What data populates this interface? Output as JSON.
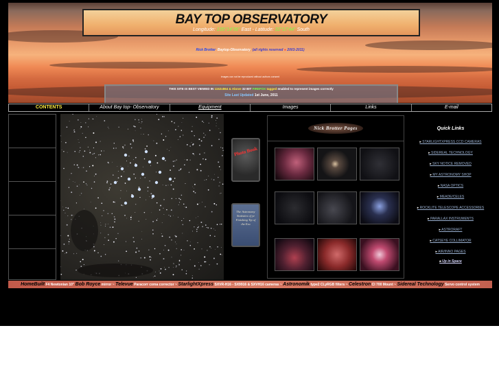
{
  "header": {
    "title": "BAY TOP OBSERVATORY",
    "longitude_label": "Longitude:",
    "longitude_value": "135°14'36\"",
    "longitude_dir": "East -",
    "latitude_label": "Latitude:",
    "latitude_value": "32°17'44\"",
    "latitude_dir": "South"
  },
  "byline": {
    "author": "Rick Brotter",
    "site": "Baytop-Observatory",
    "rights": "(all rights reserved",
    "years": "2003-2011)"
  },
  "notice": "images can not be reproduced without authors consent",
  "info": {
    "prefix": "THIS SITE IS BEST VIEWED IN",
    "resolution": "1152x864 & Above",
    "bits": "32 BIT",
    "firefox": "FIREFOX",
    "tagged": "tagged",
    "suffix": "enabled to represent images correctly",
    "updated_label": "Site Last Updated",
    "updated_value": "1st June, 2011"
  },
  "nav": [
    "CONTENTS",
    "About Bay top- Observatory",
    "Equipment",
    "Images",
    "Links",
    "E-mail"
  ],
  "photo_book_label": "Photo Book",
  "stats_book_label": "The Astronomy Statistics of ye Finishing Tip of the Era",
  "gallery_title": "Nick Brotter Pages",
  "quick_links": {
    "title": "Quick Links",
    "items": [
      "STARLIGHTXPRESS CCD CAMERAS",
      "SIDEREAL TECHNOLOGY",
      "SKY NOTICE REMOVED",
      "MY ASTRONOMY SHOP",
      "NASA OPTICS",
      "MEADE/CELES",
      "ROCKLITE TELESCOPE ACCESSORIES",
      "PARALLAX INSTRUMENTS",
      "ASTRORAFT",
      "CATSEYE COLLIMATOR",
      "AIR/INNO PAGES",
      "Up in Space"
    ]
  },
  "equipment_strip": {
    "items": [
      [
        "HomeBuilt",
        "F4  Newtonian 10\""
      ],
      [
        "Bob Royce",
        "mirror"
      ],
      [
        "Televue",
        "Paracorr coma corrector"
      ],
      [
        "StarlightXpress",
        "SXVR-H16 - SX9916 & SXVH16 cameras"
      ],
      [
        "Astronomik",
        "type2 CLyRGB filters"
      ],
      [
        "Celestron",
        "CI 700 Mount"
      ],
      [
        "Sidereal Technology",
        "Servo control system"
      ]
    ]
  },
  "colors": {
    "page_bg": "#000000",
    "nav_active": "#ffee44",
    "link": "#9ab0d0",
    "equipment_bar": "#c25a4a"
  }
}
